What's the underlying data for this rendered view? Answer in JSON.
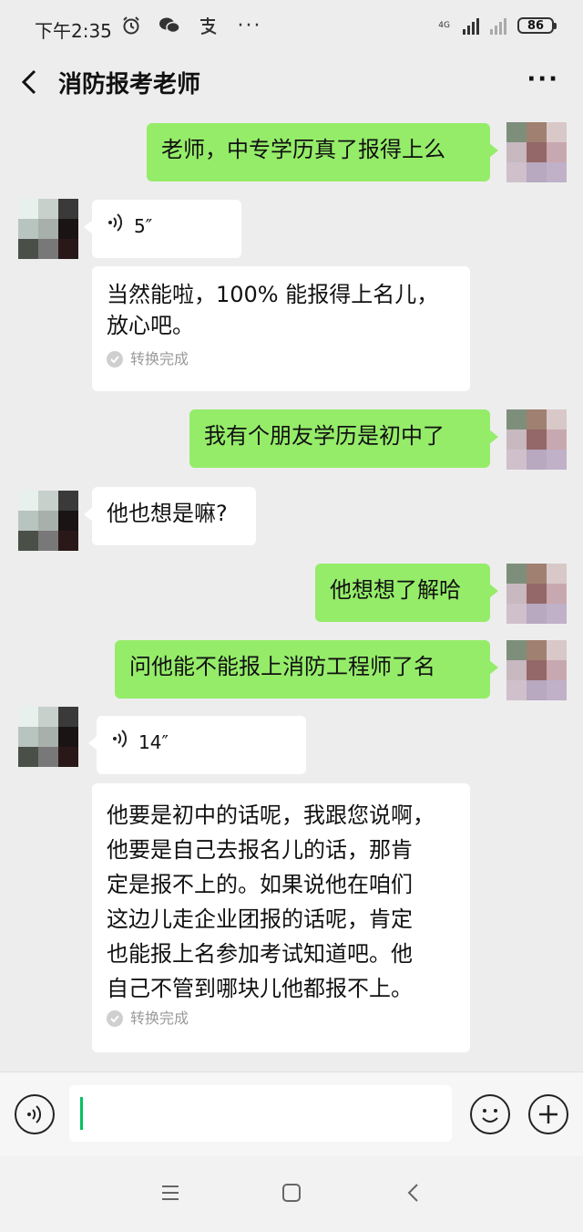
{
  "status_bar": {
    "time": "下午2:35",
    "network_label": "4G",
    "battery": "86"
  },
  "chat": {
    "title": "消防报考老师"
  },
  "messages": [
    {
      "side": "right",
      "type": "text",
      "text": "老师，中专学历真了报得上么"
    },
    {
      "side": "left",
      "type": "voice",
      "duration": "5″",
      "transcript": [
        "当然能啦，100% 能报得上名儿，",
        "放心吧。"
      ],
      "status": "转换完成"
    },
    {
      "side": "right",
      "type": "text",
      "text": "我有个朋友学历是初中了"
    },
    {
      "side": "left",
      "type": "text",
      "text": "他也想是嘛?"
    },
    {
      "side": "right",
      "type": "text",
      "text": "他想想了解哈"
    },
    {
      "side": "right",
      "type": "text",
      "text": "问他能不能报上消防工程师了名"
    },
    {
      "side": "left",
      "type": "voice",
      "duration": "14″",
      "transcript": [
        "他要是初中的话呢，我跟您说啊，",
        "他要是自己去报名儿的话，那肯",
        "定是报不上的。如果说他在咱们",
        "这边儿走企业团报的话呢，肯定",
        "也能报上名参加考试知道吧。他",
        "自己不管到哪块儿他都报不上。"
      ],
      "status": "转换完成"
    }
  ],
  "input_bar": {
    "value": ""
  },
  "icons": {
    "alarm": "alarm-clock-icon",
    "wechat": "wechat-icon",
    "alipay": "alipay-icon",
    "voice": "voice-wave-icon",
    "emoji": "emoji-icon",
    "plus": "plus-icon",
    "back": "back-arrow-icon",
    "more": "more-icon"
  },
  "colors": {
    "sent_bubble": "#95ec69",
    "received_bubble": "#ffffff",
    "background": "#ededed",
    "cursor": "#07c160"
  }
}
